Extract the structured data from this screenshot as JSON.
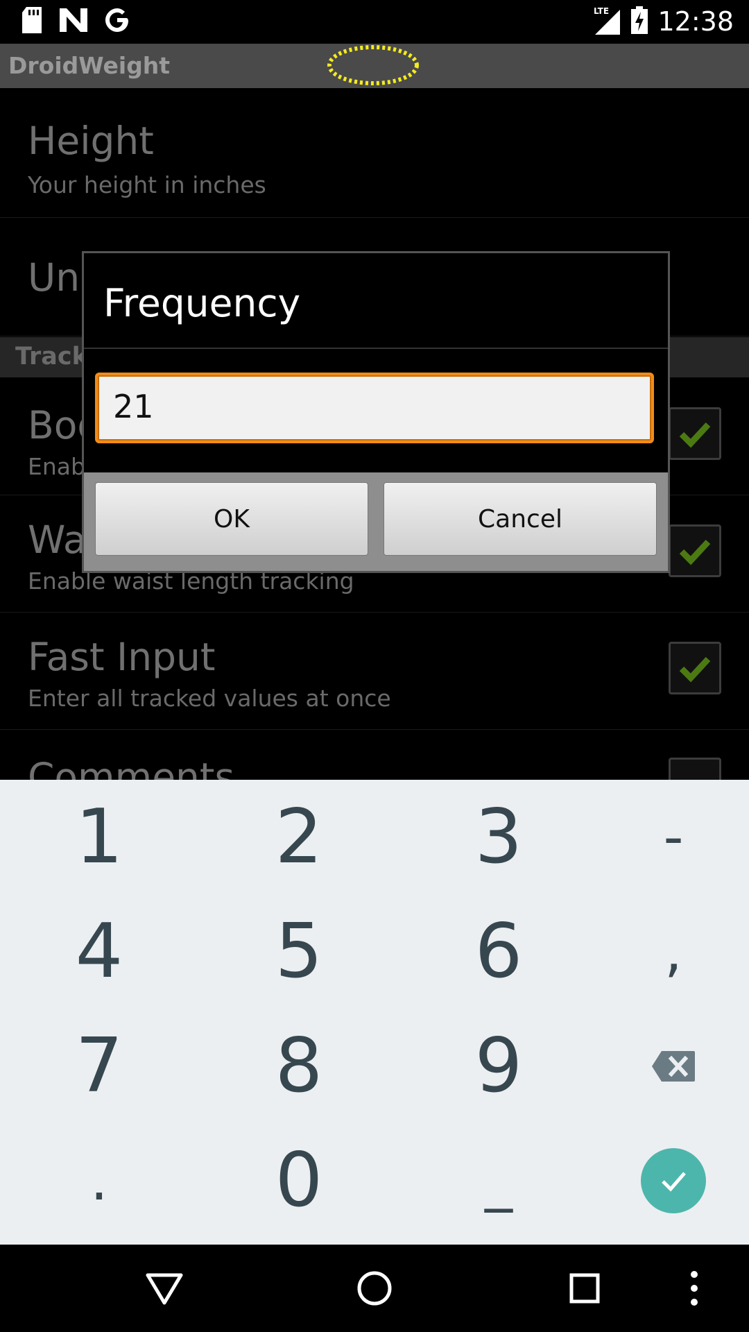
{
  "status_bar": {
    "time": "12:38",
    "network": "LTE",
    "icons": [
      "sd-card-icon",
      "n-notification-icon",
      "google-icon",
      "lte-signal-icon",
      "battery-charging-icon"
    ]
  },
  "app": {
    "title": "DroidWeight"
  },
  "preferences": [
    {
      "title": "Height",
      "subtitle": "Your height in inches"
    },
    {
      "title": "Units",
      "subtitle": ""
    },
    {
      "title": "Body fat",
      "subtitle": "Enable body fat tracking",
      "checked": true
    },
    {
      "title": "Waist",
      "subtitle": "Enable waist length tracking",
      "checked": true
    },
    {
      "title": "Fast Input",
      "subtitle": "Enter all tracked values at once",
      "checked": true
    },
    {
      "title": "Comments",
      "subtitle": ""
    }
  ],
  "section_header": "Tracking Settings",
  "dialog": {
    "title": "Frequency",
    "input_value": "21",
    "ok_label": "OK",
    "cancel_label": "Cancel"
  },
  "keypad": {
    "keys": [
      "1",
      "2",
      "3",
      "-",
      "4",
      "5",
      "6",
      ",",
      "7",
      "8",
      "9",
      ".",
      "0",
      "_"
    ]
  },
  "colors": {
    "accent_orange": "#f28c18",
    "done_teal": "#4db6ac",
    "key_text": "#37474f",
    "keypad_bg": "#eceff1"
  }
}
